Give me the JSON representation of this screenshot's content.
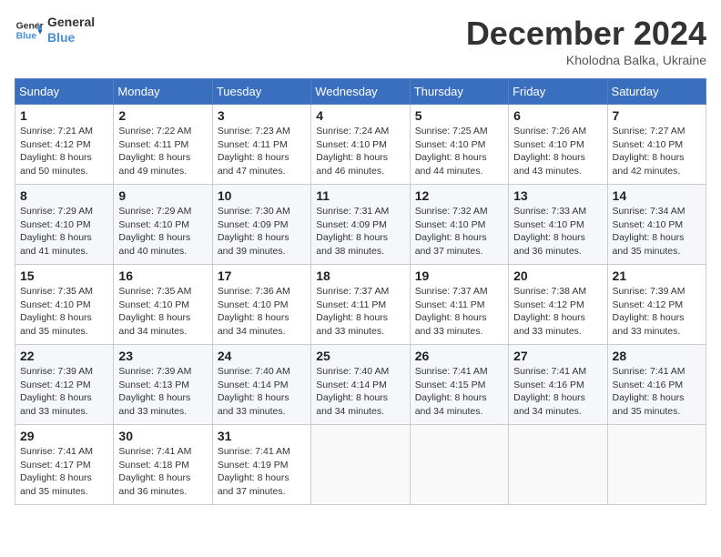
{
  "header": {
    "logo_line1": "General",
    "logo_line2": "Blue",
    "month": "December 2024",
    "location": "Kholodna Balka, Ukraine"
  },
  "weekdays": [
    "Sunday",
    "Monday",
    "Tuesday",
    "Wednesday",
    "Thursday",
    "Friday",
    "Saturday"
  ],
  "weeks": [
    [
      {
        "day": "1",
        "sunrise": "7:21 AM",
        "sunset": "4:12 PM",
        "daylight": "8 hours and 50 minutes."
      },
      {
        "day": "2",
        "sunrise": "7:22 AM",
        "sunset": "4:11 PM",
        "daylight": "8 hours and 49 minutes."
      },
      {
        "day": "3",
        "sunrise": "7:23 AM",
        "sunset": "4:11 PM",
        "daylight": "8 hours and 47 minutes."
      },
      {
        "day": "4",
        "sunrise": "7:24 AM",
        "sunset": "4:10 PM",
        "daylight": "8 hours and 46 minutes."
      },
      {
        "day": "5",
        "sunrise": "7:25 AM",
        "sunset": "4:10 PM",
        "daylight": "8 hours and 44 minutes."
      },
      {
        "day": "6",
        "sunrise": "7:26 AM",
        "sunset": "4:10 PM",
        "daylight": "8 hours and 43 minutes."
      },
      {
        "day": "7",
        "sunrise": "7:27 AM",
        "sunset": "4:10 PM",
        "daylight": "8 hours and 42 minutes."
      }
    ],
    [
      {
        "day": "8",
        "sunrise": "7:29 AM",
        "sunset": "4:10 PM",
        "daylight": "8 hours and 41 minutes."
      },
      {
        "day": "9",
        "sunrise": "7:29 AM",
        "sunset": "4:10 PM",
        "daylight": "8 hours and 40 minutes."
      },
      {
        "day": "10",
        "sunrise": "7:30 AM",
        "sunset": "4:09 PM",
        "daylight": "8 hours and 39 minutes."
      },
      {
        "day": "11",
        "sunrise": "7:31 AM",
        "sunset": "4:09 PM",
        "daylight": "8 hours and 38 minutes."
      },
      {
        "day": "12",
        "sunrise": "7:32 AM",
        "sunset": "4:10 PM",
        "daylight": "8 hours and 37 minutes."
      },
      {
        "day": "13",
        "sunrise": "7:33 AM",
        "sunset": "4:10 PM",
        "daylight": "8 hours and 36 minutes."
      },
      {
        "day": "14",
        "sunrise": "7:34 AM",
        "sunset": "4:10 PM",
        "daylight": "8 hours and 35 minutes."
      }
    ],
    [
      {
        "day": "15",
        "sunrise": "7:35 AM",
        "sunset": "4:10 PM",
        "daylight": "8 hours and 35 minutes."
      },
      {
        "day": "16",
        "sunrise": "7:35 AM",
        "sunset": "4:10 PM",
        "daylight": "8 hours and 34 minutes."
      },
      {
        "day": "17",
        "sunrise": "7:36 AM",
        "sunset": "4:10 PM",
        "daylight": "8 hours and 34 minutes."
      },
      {
        "day": "18",
        "sunrise": "7:37 AM",
        "sunset": "4:11 PM",
        "daylight": "8 hours and 33 minutes."
      },
      {
        "day": "19",
        "sunrise": "7:37 AM",
        "sunset": "4:11 PM",
        "daylight": "8 hours and 33 minutes."
      },
      {
        "day": "20",
        "sunrise": "7:38 AM",
        "sunset": "4:12 PM",
        "daylight": "8 hours and 33 minutes."
      },
      {
        "day": "21",
        "sunrise": "7:39 AM",
        "sunset": "4:12 PM",
        "daylight": "8 hours and 33 minutes."
      }
    ],
    [
      {
        "day": "22",
        "sunrise": "7:39 AM",
        "sunset": "4:12 PM",
        "daylight": "8 hours and 33 minutes."
      },
      {
        "day": "23",
        "sunrise": "7:39 AM",
        "sunset": "4:13 PM",
        "daylight": "8 hours and 33 minutes."
      },
      {
        "day": "24",
        "sunrise": "7:40 AM",
        "sunset": "4:14 PM",
        "daylight": "8 hours and 33 minutes."
      },
      {
        "day": "25",
        "sunrise": "7:40 AM",
        "sunset": "4:14 PM",
        "daylight": "8 hours and 34 minutes."
      },
      {
        "day": "26",
        "sunrise": "7:41 AM",
        "sunset": "4:15 PM",
        "daylight": "8 hours and 34 minutes."
      },
      {
        "day": "27",
        "sunrise": "7:41 AM",
        "sunset": "4:16 PM",
        "daylight": "8 hours and 34 minutes."
      },
      {
        "day": "28",
        "sunrise": "7:41 AM",
        "sunset": "4:16 PM",
        "daylight": "8 hours and 35 minutes."
      }
    ],
    [
      {
        "day": "29",
        "sunrise": "7:41 AM",
        "sunset": "4:17 PM",
        "daylight": "8 hours and 35 minutes."
      },
      {
        "day": "30",
        "sunrise": "7:41 AM",
        "sunset": "4:18 PM",
        "daylight": "8 hours and 36 minutes."
      },
      {
        "day": "31",
        "sunrise": "7:41 AM",
        "sunset": "4:19 PM",
        "daylight": "8 hours and 37 minutes."
      },
      null,
      null,
      null,
      null
    ]
  ]
}
